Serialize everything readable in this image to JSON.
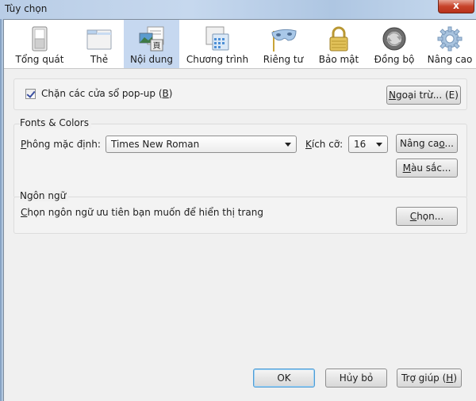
{
  "window": {
    "title": "Tùy chọn",
    "close_glyph": "x"
  },
  "toolbar": {
    "items": [
      {
        "label": "Tổng quát",
        "icon": "switch-icon",
        "active": false
      },
      {
        "label": "Thẻ",
        "icon": "tabs-window-icon",
        "active": false
      },
      {
        "label": "Nội dung",
        "icon": "content-icon",
        "active": true
      },
      {
        "label": "Chương trình",
        "icon": "applications-icon",
        "active": false
      },
      {
        "label": "Riêng tư",
        "icon": "mask-icon",
        "active": false
      },
      {
        "label": "Bảo mật",
        "icon": "padlock-icon",
        "active": false
      },
      {
        "label": "Đồng bộ",
        "icon": "sync-icon",
        "active": false
      },
      {
        "label": "Nâng cao",
        "icon": "gear-icon",
        "active": false
      }
    ]
  },
  "popup": {
    "checkbox_label": "Chặn các cửa sổ pop-up (B)",
    "checkbox_label_main": "Chặn các cửa sổ pop-up (",
    "checkbox_label_key": "B",
    "checkbox_label_end": ")",
    "checked": true,
    "exceptions_button_key": "N",
    "exceptions_button_rest": "goại trừ... (E)"
  },
  "fonts": {
    "group_label": "Fonts & Colors",
    "default_font_label_key": "P",
    "default_font_label_rest": "hông mặc định:",
    "default_font_value": "Times New Roman",
    "size_label_key": "K",
    "size_label_rest": "ích cỡ:",
    "size_value": "16",
    "advanced_button_main": "Nâng ca",
    "advanced_button_key": "o",
    "advanced_button_end": "...",
    "colors_button_key": "M",
    "colors_button_rest": "àu sắc..."
  },
  "language": {
    "group_label": "Ngôn ngữ",
    "description_key": "C",
    "description_rest": "họn ngôn ngữ ưu tiên bạn muốn để hiển thị trang",
    "choose_button_key": "C",
    "choose_button_rest": "họn..."
  },
  "footer": {
    "ok_label": "OK",
    "cancel_label": "Hủy bỏ",
    "help_main": "Trợ giúp (",
    "help_key": "H",
    "help_end": ")"
  }
}
